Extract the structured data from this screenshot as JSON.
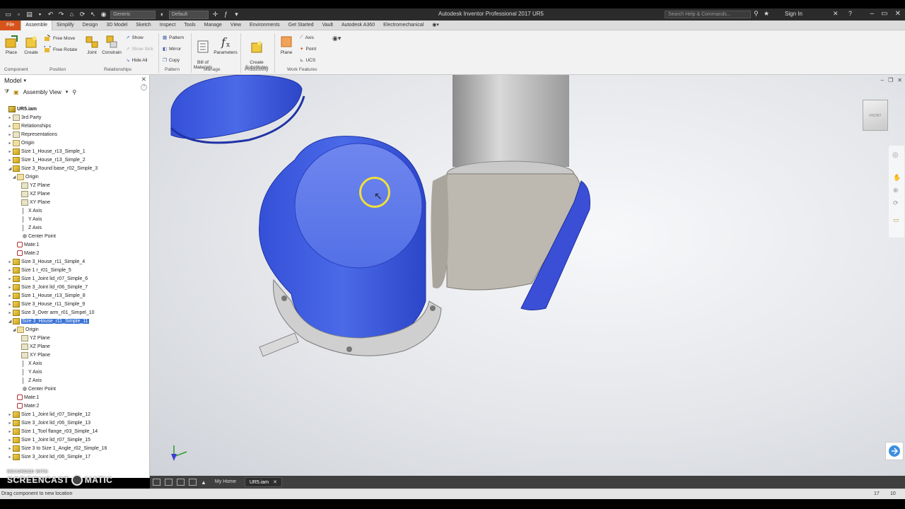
{
  "window": {
    "title": "Autodesk Inventor Professional 2017   UR5",
    "search_placeholder": "Search Help & Commands...",
    "sign_in": "Sign In",
    "appearance_combo": "Generic",
    "material_combo": "Default"
  },
  "tabs": [
    "File",
    "Assemble",
    "Simplify",
    "Design",
    "3D Model",
    "Sketch",
    "Inspect",
    "Tools",
    "Manage",
    "View",
    "Environments",
    "Get Started",
    "Vault",
    "Autodesk A360",
    "Electromechanical"
  ],
  "active_tab": "Assemble",
  "ribbon": {
    "place": "Place",
    "create": "Create",
    "free_move": "Free Move",
    "free_rotate": "Free Rotate",
    "joint": "Joint",
    "constrain": "Constrain",
    "show": "Show",
    "show_sick": "Show Sick",
    "hide_all": "Hide All",
    "pattern": "Pattern",
    "mirror": "Mirror",
    "copy": "Copy",
    "bill_of_materials": "Bill of\nMaterials",
    "parameters": "Parameters",
    "create_substitutes": "Create\nSubstitutes",
    "plane": "Plane",
    "axis": "Axis",
    "point": "Point",
    "ucs": "UCS",
    "panels": {
      "component": "Component",
      "position": "Position",
      "relationships": "Relationships",
      "pattern": "Pattern",
      "manage": "Manage",
      "productivity": "Productivity",
      "work_features": "Work Features"
    }
  },
  "browser": {
    "header": "Model",
    "view": "Assembly View",
    "tree": [
      {
        "label": "UR5.iam",
        "level": 0,
        "icon": "root",
        "tw": ""
      },
      {
        "label": "3rd Party",
        "level": 1,
        "icon": "plane",
        "tw": "▸"
      },
      {
        "label": "Relationships",
        "level": 1,
        "icon": "fld",
        "tw": "▸"
      },
      {
        "label": "Representations",
        "level": 1,
        "icon": "plane",
        "tw": "▸"
      },
      {
        "label": "Origin",
        "level": 1,
        "icon": "fld",
        "tw": "▸"
      },
      {
        "label": "Size 1_House_r13_Simple_1",
        "level": 1,
        "icon": "asm",
        "tw": "▸"
      },
      {
        "label": "Size 1_House_r13_Simple_2",
        "level": 1,
        "icon": "asm",
        "tw": "▸"
      },
      {
        "label": "Size 3_Round base_r02_Simple_3",
        "level": 1,
        "icon": "asm",
        "tw": "◢"
      },
      {
        "label": "Origin",
        "level": 2,
        "icon": "fld",
        "tw": "◢"
      },
      {
        "label": "YZ Plane",
        "level": 3,
        "icon": "plane",
        "tw": ""
      },
      {
        "label": "XZ Plane",
        "level": 3,
        "icon": "plane",
        "tw": ""
      },
      {
        "label": "XY Plane",
        "level": 3,
        "icon": "plane",
        "tw": ""
      },
      {
        "label": "X Axis",
        "level": 3,
        "icon": "axis",
        "tw": ""
      },
      {
        "label": "Y Axis",
        "level": 3,
        "icon": "axis",
        "tw": ""
      },
      {
        "label": "Z Axis",
        "level": 3,
        "icon": "axis",
        "tw": ""
      },
      {
        "label": "Center Point",
        "level": 3,
        "icon": "pt",
        "tw": ""
      },
      {
        "label": "Mate:1",
        "level": 2,
        "icon": "mate",
        "tw": ""
      },
      {
        "label": "Mate:2",
        "level": 2,
        "icon": "mate",
        "tw": ""
      },
      {
        "label": "Size 3_House_r11_Simple_4",
        "level": 1,
        "icon": "asm",
        "tw": "▸"
      },
      {
        "label": "Size 1 r_r01_Simple_5",
        "level": 1,
        "icon": "asm",
        "tw": "▸"
      },
      {
        "label": "Size 1_Joint lid_r07_Simple_6",
        "level": 1,
        "icon": "asm",
        "tw": "▸"
      },
      {
        "label": "Size 3_Joint lid_r06_Simple_7",
        "level": 1,
        "icon": "asm",
        "tw": "▸"
      },
      {
        "label": "Size 1_House_r13_Simple_8",
        "level": 1,
        "icon": "asm",
        "tw": "▸"
      },
      {
        "label": "Size 3_House_r11_Simple_9",
        "level": 1,
        "icon": "asm",
        "tw": "▸"
      },
      {
        "label": "Size 3_Over arm_r01_Simpel_10",
        "level": 1,
        "icon": "asm",
        "tw": "▸"
      },
      {
        "label": "Size 3_House_r11_Simple_11",
        "level": 1,
        "icon": "asm",
        "tw": "◢",
        "selected": true
      },
      {
        "label": "Origin",
        "level": 2,
        "icon": "fld",
        "tw": "◢"
      },
      {
        "label": "YZ Plane",
        "level": 3,
        "icon": "plane",
        "tw": ""
      },
      {
        "label": "XZ Plane",
        "level": 3,
        "icon": "plane",
        "tw": ""
      },
      {
        "label": "XY Plane",
        "level": 3,
        "icon": "plane",
        "tw": ""
      },
      {
        "label": "X Axis",
        "level": 3,
        "icon": "axis",
        "tw": ""
      },
      {
        "label": "Y Axis",
        "level": 3,
        "icon": "axis",
        "tw": ""
      },
      {
        "label": "Z Axis",
        "level": 3,
        "icon": "axis",
        "tw": ""
      },
      {
        "label": "Center Point",
        "level": 3,
        "icon": "pt",
        "tw": ""
      },
      {
        "label": "Mate:1",
        "level": 2,
        "icon": "mate",
        "tw": ""
      },
      {
        "label": "Mate:2",
        "level": 2,
        "icon": "mate",
        "tw": ""
      },
      {
        "label": "Size 1_Joint lid_r07_Simple_12",
        "level": 1,
        "icon": "asm",
        "tw": "▸"
      },
      {
        "label": "Size 3_Joint lid_r06_Simple_13",
        "level": 1,
        "icon": "asm",
        "tw": "▸"
      },
      {
        "label": "Size 1_Tool flange_r03_Simple_14",
        "level": 1,
        "icon": "asm",
        "tw": "▸"
      },
      {
        "label": "Size 1_Joint lid_r07_Simple_15",
        "level": 1,
        "icon": "asm",
        "tw": "▸"
      },
      {
        "label": "Size 3 to Size 1_Angle_r02_Simple_16",
        "level": 1,
        "icon": "asm",
        "tw": "▸"
      },
      {
        "label": "Size 3_Joint lid_r06_Simple_17",
        "level": 1,
        "icon": "asm",
        "tw": "▸"
      }
    ]
  },
  "watermark": {
    "line1": "RECORDED WITH",
    "line2a": "SCREENCAST",
    "line2b": "MATIC"
  },
  "doc_tabs": {
    "home": "My Home",
    "active": "UR5.iam"
  },
  "status": {
    "message": "Drag component to new location",
    "n1": "17",
    "n2": "10"
  },
  "viewcube_label": "FRONT",
  "colors": {
    "accent": "#d6541b",
    "selected_blue": "#3a5fe0",
    "selection_highlight": "#3a73d6"
  }
}
